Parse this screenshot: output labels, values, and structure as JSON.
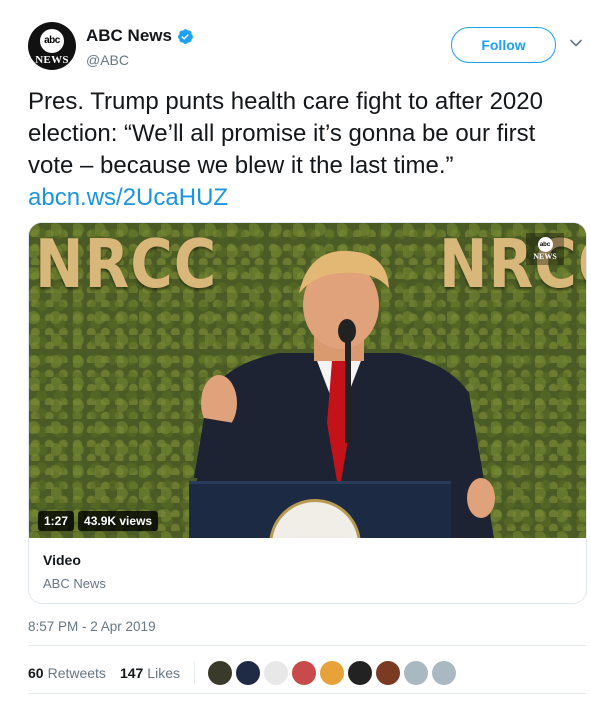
{
  "account": {
    "name": "ABC News",
    "handle": "@ABC",
    "avatar_top": "abc",
    "avatar_bottom": "NEWS",
    "verified_icon": "verified-badge-icon"
  },
  "actions": {
    "follow_label": "Follow",
    "more_icon": "chevron-down-icon"
  },
  "tweet": {
    "text": "Pres. Trump punts health care fight to after 2020 election: “We’ll all promise it’s gonna be our first vote – because we blew it the last time.” ",
    "link": "abcn.ws/2UcaHUZ"
  },
  "media": {
    "banner_left": "NRCC",
    "banner_right": "NRCC",
    "overlay_logo_top": "abc",
    "overlay_logo_bottom": "NEWS",
    "duration": "1:27",
    "views": "43.9K views",
    "card_title": "Video",
    "card_source": "ABC News"
  },
  "timestamp": "8:57 PM - 2 Apr 2019",
  "stats": {
    "retweets_count": "60",
    "retweets_label": "Retweets",
    "likes_count": "147",
    "likes_label": "Likes"
  },
  "likers": [
    {
      "color": "#3a3a2a"
    },
    {
      "color": "#1f2a44"
    },
    {
      "color": "#e8e8e8"
    },
    {
      "color": "#c94a4a"
    },
    {
      "color": "#e8a23a"
    },
    {
      "color": "#222222"
    },
    {
      "color": "#7a3b22"
    },
    {
      "color": "#aab8c2"
    },
    {
      "color": "#aab8c2"
    }
  ],
  "colors": {
    "brand_blue": "#1da1f2",
    "link_blue": "#1b95e0",
    "muted": "#657786"
  }
}
